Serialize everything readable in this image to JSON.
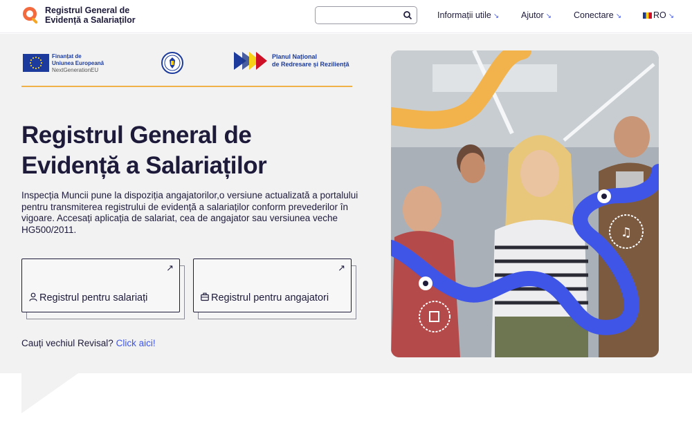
{
  "header": {
    "logo_line1": "Registrul General de",
    "logo_line2": "Evidență a Salariaților",
    "search": {
      "value": "",
      "placeholder": ""
    },
    "nav": [
      {
        "label": "Informații utile",
        "arrow": "↘"
      },
      {
        "label": "Ajutor",
        "arrow": "↘"
      },
      {
        "label": "Conectare",
        "arrow": "↘"
      },
      {
        "label": "RO",
        "arrow": "↘"
      }
    ]
  },
  "funding": {
    "eu_line1": "Finanțat de",
    "eu_line2": "Uniunea Europeană",
    "eu_line3": "NextGenerationEU",
    "pnrr_line1": "Planul Național",
    "pnrr_line2": "de Redresare și Reziliență"
  },
  "hero": {
    "title_line1": "Registrul General de",
    "title_line2": "Evidență a Salariaților",
    "intro": "Inspecția Muncii pune la dispoziția angajatorilor,o versiune actualizată a portalului pentru transmiterea registrului de evidență a salariaților conform prevederilor în vigoare. Accesați aplicația de salariat, cea de angajator sau versiunea veche HG500/2011.",
    "cards": [
      {
        "label": "Registrul pentru salariați",
        "arrow": "↗",
        "icon": "user-icon"
      },
      {
        "label": "Registrul pentru angajatori",
        "arrow": "↗",
        "icon": "briefcase-icon"
      }
    ],
    "old_question": "Cauți vechiul Revisal?",
    "old_link": "Click aici!"
  },
  "colors": {
    "accent_blue": "#3e55e8",
    "accent_orange": "#f0b247",
    "text_dark": "#1d1a3a",
    "hero_bg": "#f2f2f3"
  }
}
